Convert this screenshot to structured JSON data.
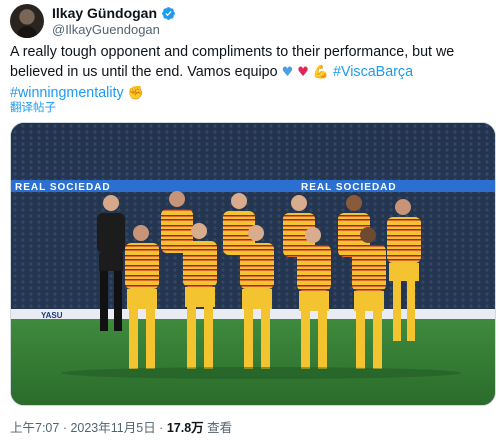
{
  "author": {
    "display_name": "Ilkay Gündogan",
    "handle": "@IlkayGuendogan",
    "verified": true
  },
  "tweet": {
    "text_main": "A really tough opponent and compliments to their performance, but we believed in us until the end. Vamos equipo ",
    "emojis_1": [
      "blue-heart",
      "red-heart",
      "flexed-biceps"
    ],
    "hashtag_1": "#ViscaBarça",
    "hashtag_2": "#winningmentality",
    "emoji_2": "fist-bump",
    "translate_label": "翻译帖子"
  },
  "media": {
    "alt": "Team photo",
    "banner_text": "REAL SOCIEDAD",
    "board_text": "YASU"
  },
  "meta": {
    "time": "上午7:07",
    "separator": " · ",
    "date": "2023年11月5日",
    "views_count": "17.8万",
    "views_label": " 查看"
  },
  "colors": {
    "link": "#1d9bf0",
    "secondary_text": "#536471",
    "verified": "#1d9bf0",
    "jersey_yellow": "#f4c430",
    "jersey_red": "#c8102e",
    "pitch_green": "#2f7a33"
  }
}
